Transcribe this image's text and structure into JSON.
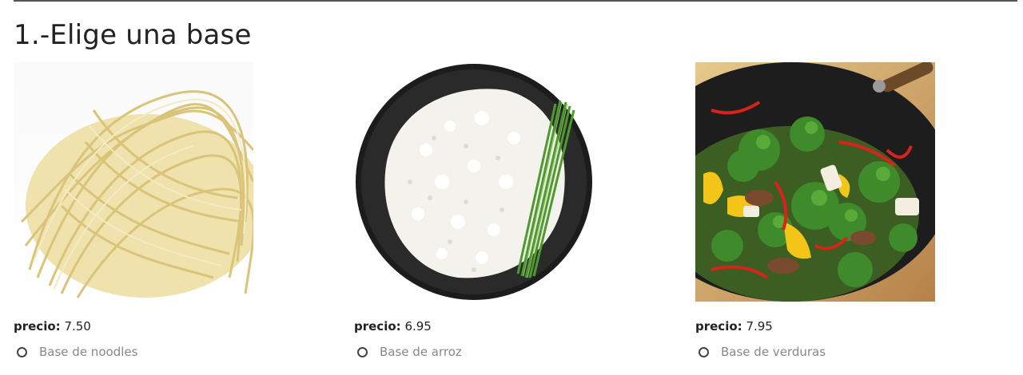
{
  "section": {
    "title": "1.-Elige una base"
  },
  "price_label": "precio:",
  "items": [
    {
      "name": "noodles",
      "price": "7.50",
      "option": "Base de noodles"
    },
    {
      "name": "arroz",
      "price": "6.95",
      "option": "Base de arroz"
    },
    {
      "name": "verduras",
      "price": "7.95",
      "option": "Base de verduras"
    }
  ],
  "colors": {
    "noodle": "#e8d89a",
    "rice_plate": "#1c1c1c",
    "broccoli": "#3f8a2a",
    "wok": "#222222"
  }
}
